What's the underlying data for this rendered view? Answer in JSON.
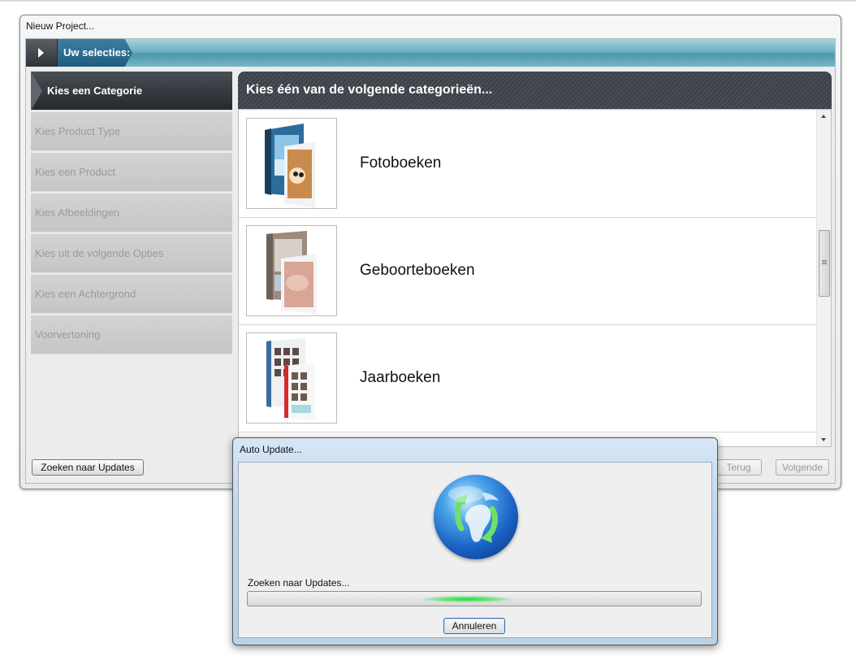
{
  "main_window": {
    "title": "Nieuw Project...",
    "selection_bar_label": "Uw selecties:",
    "nav_items": [
      {
        "label": "Kies een Categorie",
        "active": true
      },
      {
        "label": "Kies Product Type",
        "active": false
      },
      {
        "label": "Kies een Product",
        "active": false
      },
      {
        "label": "Kies Afbeeldingen",
        "active": false
      },
      {
        "label": "Kies uit de volgende Opties",
        "active": false
      },
      {
        "label": "Kies een Achtergrond",
        "active": false
      },
      {
        "label": "Voorvertoning",
        "active": false
      }
    ],
    "panel_header": "Kies één van de volgende categorieën...",
    "categories": [
      {
        "label": "Fotoboeken",
        "thumbnail": "photobook-thumbnail"
      },
      {
        "label": "Geboorteboeken",
        "thumbnail": "birthbook-thumbnail"
      },
      {
        "label": "Jaarboeken",
        "thumbnail": "yearbook-thumbnail"
      }
    ],
    "buttons": {
      "updates": "Zoeken naar Updates",
      "back": "Terug",
      "next": "Volgende"
    }
  },
  "dialog": {
    "title": "Auto Update...",
    "status": "Zoeken naar Updates...",
    "cancel": "Annuleren",
    "progress_indeterminate": true,
    "icon": "globe-refresh-icon"
  },
  "colors": {
    "selection_bar": "#4f97ac",
    "active_nav": "#2f3238",
    "progress_glow": "#20e03a"
  }
}
